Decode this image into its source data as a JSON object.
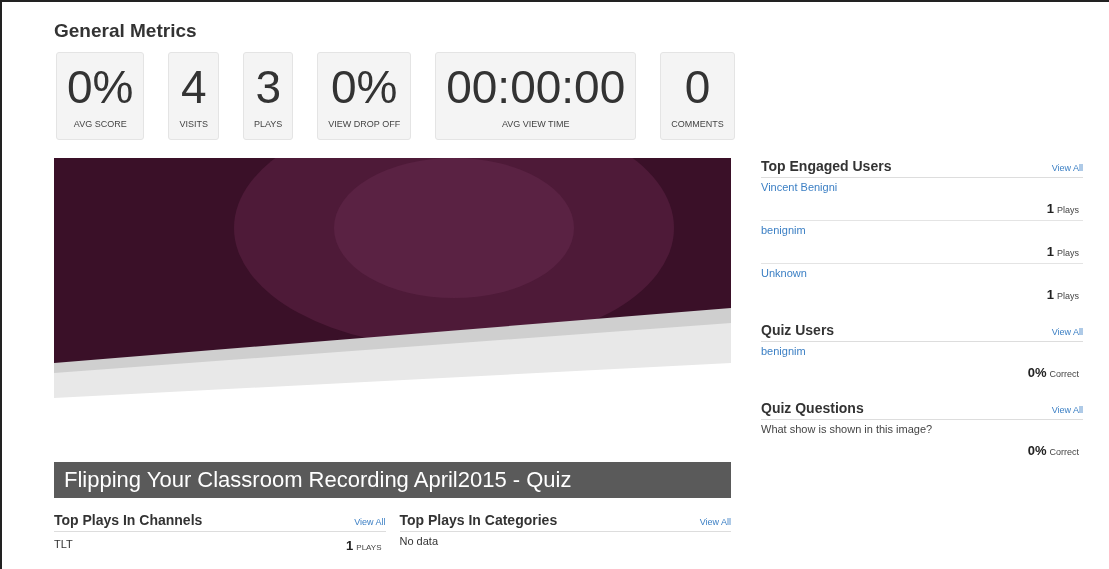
{
  "title": "General Metrics",
  "metrics": [
    {
      "value": "0%",
      "label": "AVG SCORE"
    },
    {
      "value": "4",
      "label": "VISITS"
    },
    {
      "value": "3",
      "label": "PLAYS"
    },
    {
      "value": "0%",
      "label": "VIEW DROP OFF"
    },
    {
      "value": "00:00:00",
      "label": "AVG VIEW TIME"
    },
    {
      "value": "0",
      "label": "COMMENTS"
    }
  ],
  "media_title": "Flipping Your Classroom Recording April2015 - Quiz",
  "bottom_panels": [
    {
      "title": "Top Plays In Channels",
      "link": "View All",
      "rows": [
        {
          "name": "TLT",
          "count": "1",
          "unit": "PLAYS"
        }
      ]
    },
    {
      "title": "Top Plays In Categories",
      "link": "View All",
      "empty": "No data"
    }
  ],
  "side_panels": [
    {
      "title": "Top Engaged Users",
      "link": "View All",
      "rows": [
        {
          "name": "Vincent Benigni",
          "count": "1",
          "unit": "Plays"
        },
        {
          "name": "benignim",
          "count": "1",
          "unit": "Plays"
        },
        {
          "name": "Unknown",
          "count": "1",
          "unit": "Plays"
        }
      ]
    },
    {
      "title": "Quiz Users",
      "link": "View All",
      "rows": [
        {
          "name": "benignim",
          "count": "0%",
          "unit": "Correct"
        }
      ]
    },
    {
      "title": "Quiz Questions",
      "link": "View All",
      "rows": [
        {
          "name": "What show is shown in this image?",
          "kind": "question",
          "count": "0%",
          "unit": "Correct"
        }
      ]
    }
  ]
}
